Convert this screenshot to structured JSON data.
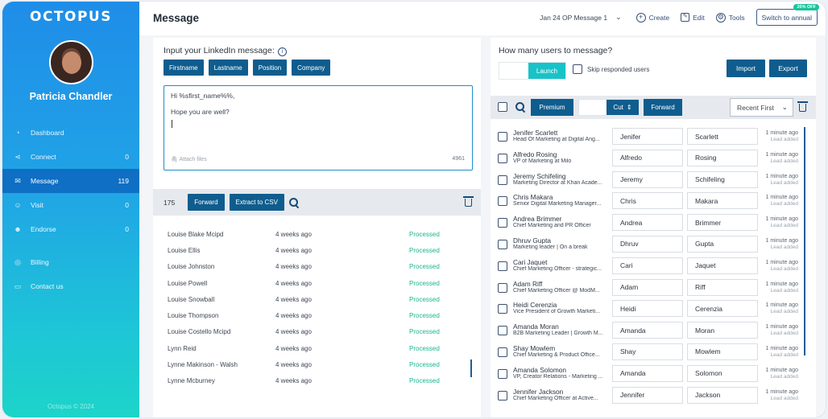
{
  "sidebar": {
    "logo": "OCTOPUS",
    "user_name": "Patricia Chandler",
    "items": [
      {
        "label": "Dashboard",
        "count": "",
        "icon": "dashboard-icon"
      },
      {
        "label": "Connect",
        "count": "0",
        "icon": "connect-icon"
      },
      {
        "label": "Message",
        "count": "119",
        "icon": "message-icon"
      },
      {
        "label": "Visit",
        "count": "0",
        "icon": "visit-icon"
      },
      {
        "label": "Endorse",
        "count": "0",
        "icon": "endorse-icon"
      }
    ],
    "secondary": [
      {
        "label": "Billing",
        "icon": "billing-icon"
      },
      {
        "label": "Contact us",
        "icon": "contact-icon"
      }
    ],
    "copyright": "Octopus © 2024"
  },
  "header": {
    "title": "Message",
    "campaign": "Jan 24 OP Message 1",
    "create": "Create",
    "edit": "Edit",
    "tools": "Tools",
    "annual": "Switch to annual",
    "badge": "20% OFF"
  },
  "left": {
    "heading": "Input your LinkedIn message:",
    "chips": [
      "Firstname",
      "Lastname",
      "Position",
      "Company"
    ],
    "message_line1": "Hi %sfirst_name%%,",
    "message_line2": "Hope you are well?",
    "attach": "Attach files",
    "char_count": "4961",
    "count": "175",
    "forward": "Forward",
    "extract": "Extract to CSV",
    "rows": [
      {
        "name": "Louise Blake Mcipd",
        "time": "4 weeks ago",
        "status": "Processed"
      },
      {
        "name": "Louise Ellis",
        "time": "4 weeks ago",
        "status": "Processed"
      },
      {
        "name": "Louise Johnston",
        "time": "4 weeks ago",
        "status": "Processed"
      },
      {
        "name": "Louise Powell",
        "time": "4 weeks ago",
        "status": "Processed"
      },
      {
        "name": "Louise Snowball",
        "time": "4 weeks ago",
        "status": "Processed"
      },
      {
        "name": "Louise Thompson",
        "time": "4 weeks ago",
        "status": "Processed"
      },
      {
        "name": "Louise Costello Mcipd",
        "time": "4 weeks ago",
        "status": "Processed"
      },
      {
        "name": "Lynn Reid",
        "time": "4 weeks ago",
        "status": "Processed"
      },
      {
        "name": "Lynne Makinson - Walsh",
        "time": "4 weeks ago",
        "status": "Processed"
      },
      {
        "name": "Lynne Mcburney",
        "time": "4 weeks ago",
        "status": "Processed"
      }
    ]
  },
  "right": {
    "heading": "How many users to message?",
    "launch": "Launch",
    "skip": "Skip responded users",
    "import": "Import",
    "export": "Export",
    "premium": "Premium",
    "cut": "Cut",
    "forward": "Forward",
    "sort": "Recent First",
    "rows": [
      {
        "name": "Jenifer Scarlett",
        "title": "Head Of Marketing at Digital Ang...",
        "first": "Jenifer",
        "last": "Scarlett",
        "time": "1 minute ago",
        "sub": "Lead added"
      },
      {
        "name": "Alfredo Rosing",
        "title": "VP of Marketing at Milo",
        "first": "Alfredo",
        "last": "Rosing",
        "time": "1 minute ago",
        "sub": "Lead added"
      },
      {
        "name": "Jeremy Schifeling",
        "title": "Marketing Director at Khan Acade...",
        "first": "Jeremy",
        "last": "Schifeling",
        "time": "1 minute ago",
        "sub": "Lead added"
      },
      {
        "name": "Chris Makara",
        "title": "Senior Digital Marketing Manager...",
        "first": "Chris",
        "last": "Makara",
        "time": "1 minute ago",
        "sub": "Lead added"
      },
      {
        "name": "Andrea Brimmer",
        "title": "Chief Marketing and PR Officer",
        "first": "Andrea",
        "last": "Brimmer",
        "time": "1 minute ago",
        "sub": "Lead added"
      },
      {
        "name": "Dhruv Gupta",
        "title": "Marketing leader | On a break",
        "first": "Dhruv",
        "last": "Gupta",
        "time": "1 minute ago",
        "sub": "Lead added"
      },
      {
        "name": "Cari Jaquet",
        "title": "Chief Marketing Officer - strategic...",
        "first": "Cari",
        "last": "Jaquet",
        "time": "1 minute ago",
        "sub": "Lead added"
      },
      {
        "name": "Adam Riff",
        "title": "Chief Marketing Officer @ ModM...",
        "first": "Adam",
        "last": "Riff",
        "time": "1 minute ago",
        "sub": "Lead added"
      },
      {
        "name": "Heidi Cerenzia",
        "title": "Vice President of Growth Marketi...",
        "first": "Heidi",
        "last": "Cerenzia",
        "time": "1 minute ago",
        "sub": "Lead added"
      },
      {
        "name": "Amanda Moran",
        "title": "B2B Marketing Leader | Growth M...",
        "first": "Amanda",
        "last": "Moran",
        "time": "1 minute ago",
        "sub": "Lead added"
      },
      {
        "name": "Shay Mowlem",
        "title": "Chief Marketing & Product Office...",
        "first": "Shay",
        "last": "Mowlem",
        "time": "1 minute ago",
        "sub": "Lead added"
      },
      {
        "name": "Amanda Solomon",
        "title": "VP, Creator Relations - Marketing ...",
        "first": "Amanda",
        "last": "Solomon",
        "time": "1 minute ago",
        "sub": "Lead added"
      },
      {
        "name": "Jennifer Jackson",
        "title": "Chief Marketing Officer at Active...",
        "first": "Jennifer",
        "last": "Jackson",
        "time": "1 minute ago",
        "sub": "Lead added"
      }
    ]
  }
}
